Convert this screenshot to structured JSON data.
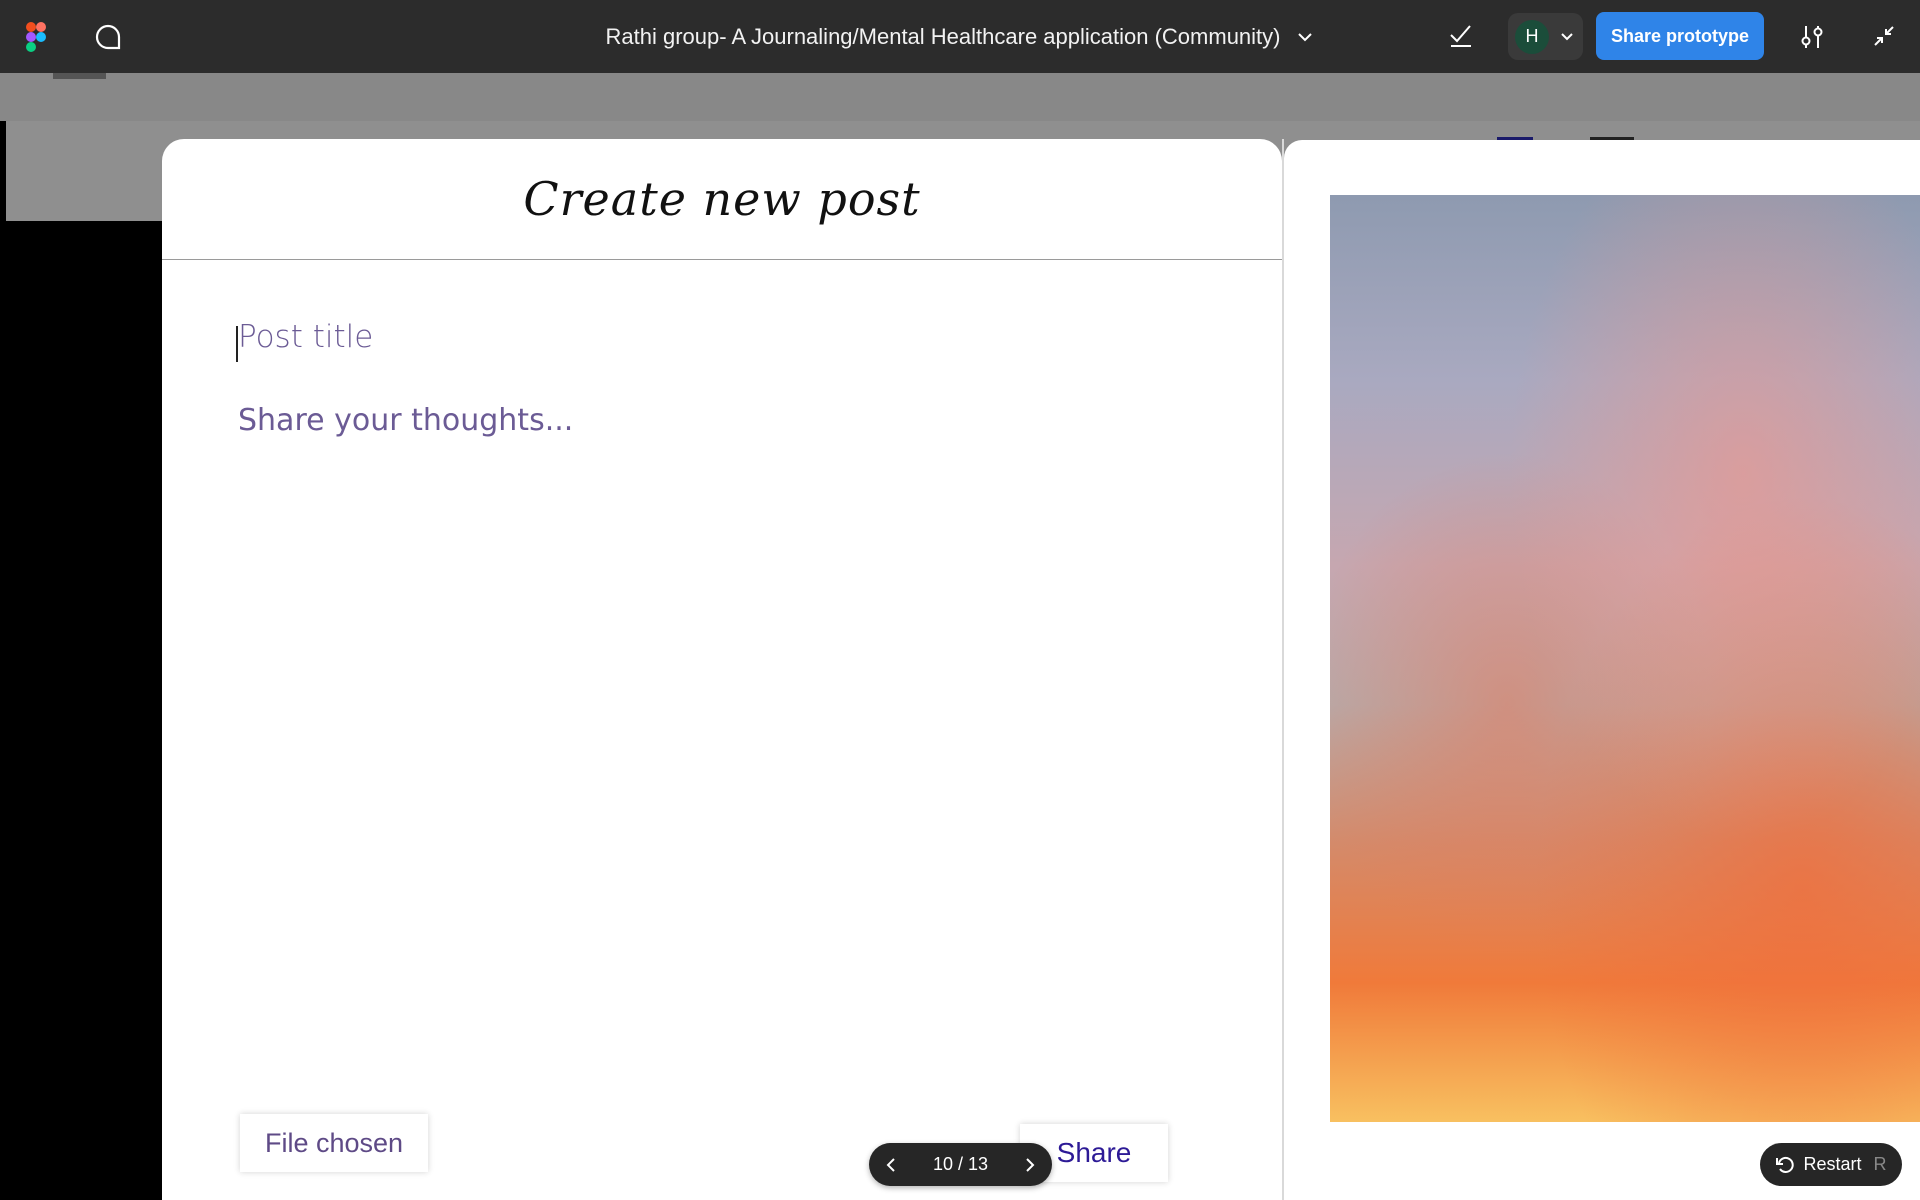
{
  "toolbar": {
    "file_title": "Rathi group- A Journaling/Mental Healthcare application (Community)",
    "avatar_initial": "H",
    "share_label": "Share prototype"
  },
  "modal": {
    "title": "Create new post",
    "post_title_placeholder": "Post title",
    "thoughts_placeholder": "Share your thoughts...",
    "file_status": "File chosen",
    "share_label": "Share"
  },
  "pager": {
    "count": "10 / 13"
  },
  "restart": {
    "label": "Restart",
    "shortcut": "R"
  },
  "colors": {
    "toolbar_bg": "#2c2c2c",
    "accent": "#2f84e8",
    "placeholder": "#6b5b95",
    "share_text": "#2d1a96"
  }
}
